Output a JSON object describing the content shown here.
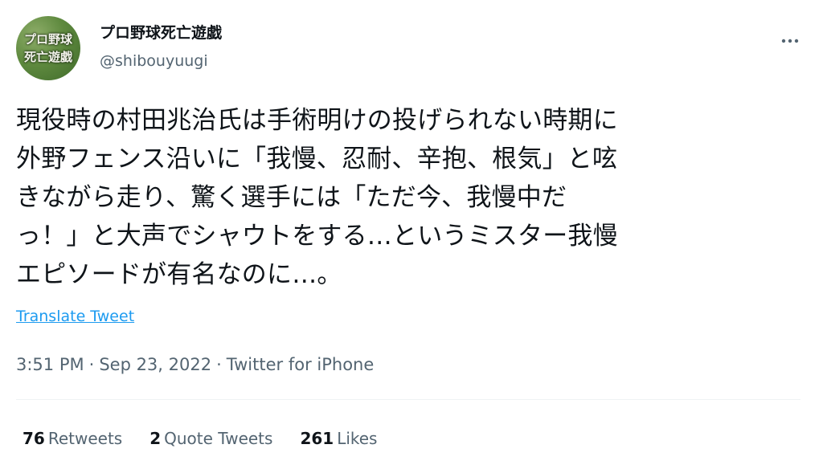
{
  "author": {
    "display_name": "プロ野球死亡遊戯",
    "handle": "@shibouyuugi",
    "avatar_text_line1": "プロ野球",
    "avatar_text_line2": "死亡遊戯"
  },
  "tweet": {
    "text": "現役時の村田兆治氏は手術明けの投げられない時期に\n外野フェンス沿いに「我慢、忍耐、辛抱、根気」と呟\nきながら走り、驚く選手には「ただ今、我慢中だ\nっ！」と大声でシャウトをする…というミスター我慢\nエピソードが有名なのに…。",
    "translate_label": "Translate Tweet",
    "time": "3:51 PM",
    "date": "Sep 23, 2022",
    "source": "Twitter for iPhone",
    "separator": "·"
  },
  "stats": {
    "retweets_count": "76",
    "retweets_label": "Retweets",
    "quotes_count": "2",
    "quotes_label": "Quote Tweets",
    "likes_count": "261",
    "likes_label": "Likes"
  },
  "icons": {
    "more": "more-horizontal-icon"
  },
  "colors": {
    "text_primary": "#0f1419",
    "text_secondary": "#536471",
    "link": "#1d9bf0",
    "divider": "#eff3f4"
  }
}
